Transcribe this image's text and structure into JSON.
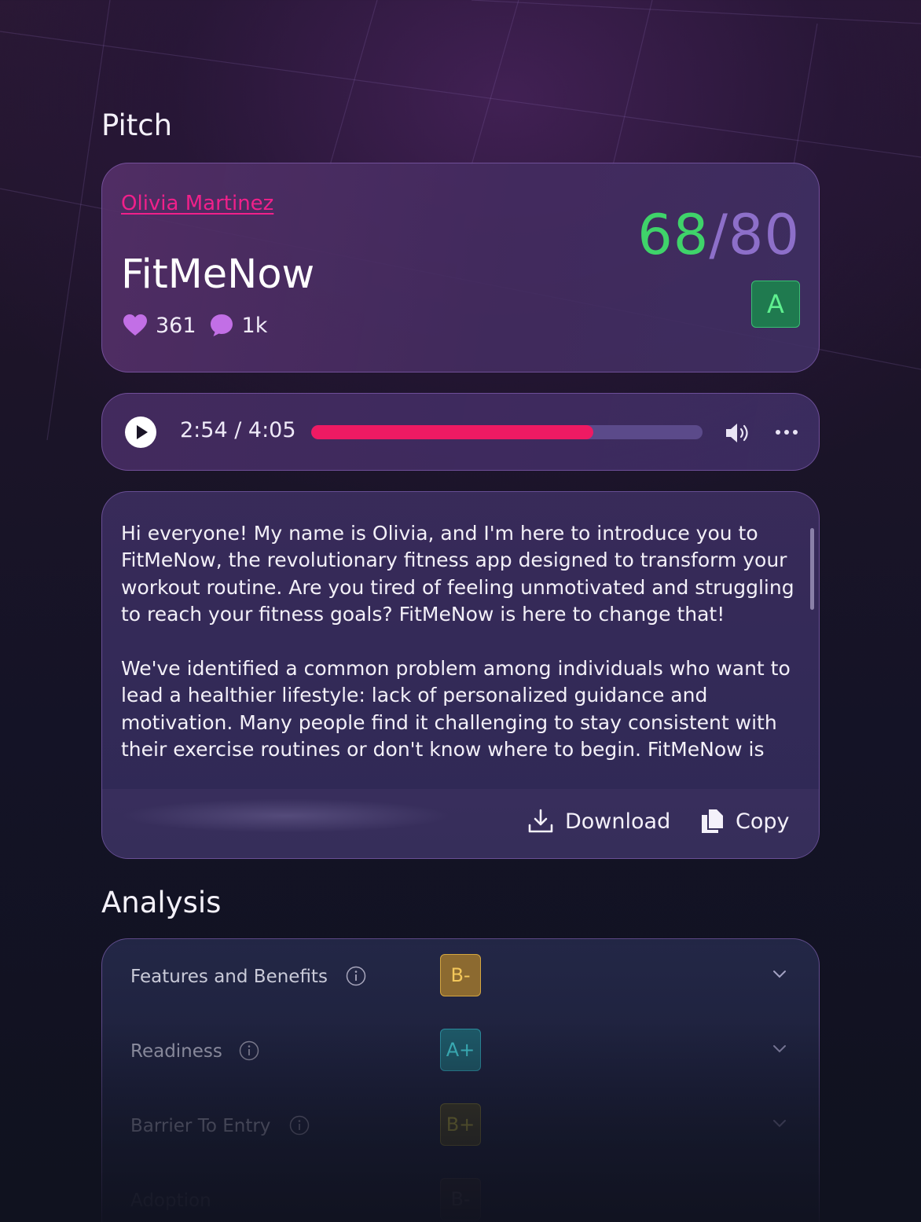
{
  "pitch": {
    "section_title": "Pitch",
    "author": "Olivia Martinez",
    "product_name": "FitMeNow",
    "likes": "361",
    "comments": "1k",
    "score": "68",
    "score_max": "80",
    "grade": "A"
  },
  "player": {
    "time": "2:54 / 4:05",
    "progress_fraction": 0.72
  },
  "transcript": {
    "paragraphs": [
      "Hi everyone! My name is Olivia, and I'm here to introduce you to FitMeNow, the revolutionary fitness app designed to transform your workout routine. Are you tired of feeling unmotivated and struggling to reach your fitness goals? FitMeNow is here to change that!",
      "We've identified a common problem among individuals who want to lead a healthier lifestyle: lack of personalized guidance and motivation. Many people find it challenging to stay consistent with their exercise routines or don't know where to begin. FitMeNow is"
    ],
    "download_label": "Download",
    "copy_label": "Copy"
  },
  "analysis": {
    "section_title": "Analysis",
    "rows": [
      {
        "label": "Features and Benefits",
        "grade": "B-"
      },
      {
        "label": "Readiness",
        "grade": "A+"
      },
      {
        "label": "Barrier To Entry",
        "grade": "B+"
      },
      {
        "label": "Adoption",
        "grade": "B-"
      }
    ]
  },
  "colors": {
    "author_link": "#f0208a",
    "score_value": "#3fd36a",
    "progress_fill": "#ee1a63",
    "grade_a": "#1f7a4f"
  }
}
